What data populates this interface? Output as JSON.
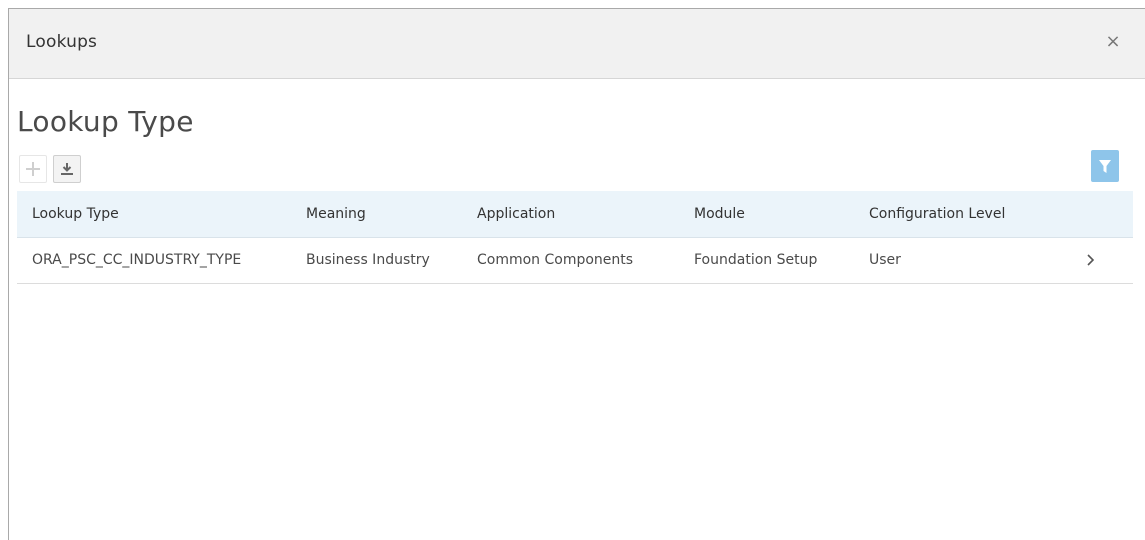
{
  "dialog": {
    "title": "Lookups",
    "close_label": "×"
  },
  "page": {
    "title": "Lookup Type"
  },
  "toolbar": {
    "add_icon": "plus-icon",
    "download_icon": "download-icon",
    "filter_icon": "filter-icon",
    "filter_color": "#8ec5ea"
  },
  "table": {
    "columns": [
      "Lookup Type",
      "Meaning",
      "Application",
      "Module",
      "Configuration Level"
    ],
    "rows": [
      {
        "lookup_type": "ORA_PSC_CC_INDUSTRY_TYPE",
        "meaning": "Business Industry",
        "application": "Common Components",
        "module": "Foundation Setup",
        "configuration_level": "User"
      }
    ],
    "header_color": "#ebf4fa"
  }
}
